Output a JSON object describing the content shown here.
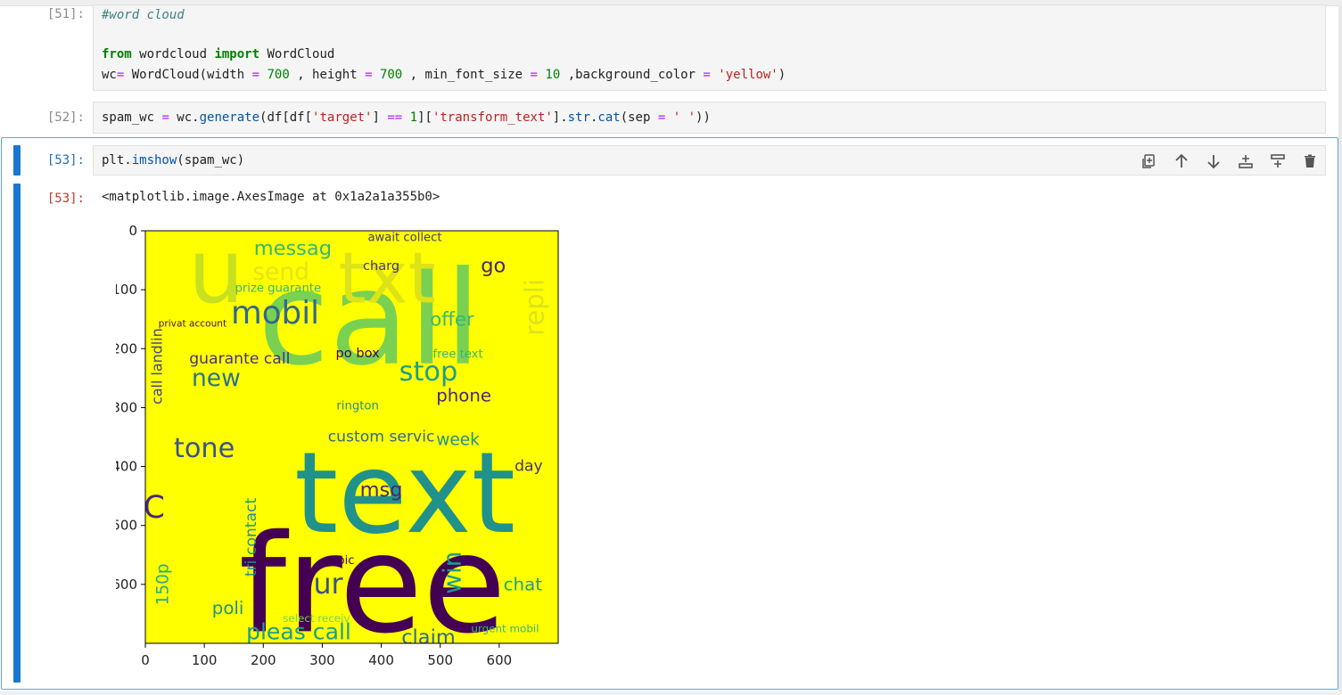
{
  "cells": [
    {
      "prompt": "[51]:",
      "lines": [
        [
          {
            "t": "#word cloud",
            "c": "cm-comment"
          }
        ],
        [],
        [
          {
            "t": "from",
            "c": "kw"
          },
          {
            "t": " wordcloud ",
            "c": ""
          },
          {
            "t": "import",
            "c": "kw"
          },
          {
            "t": " WordCloud",
            "c": ""
          }
        ],
        [
          {
            "t": "wc",
            "c": ""
          },
          {
            "t": "=",
            "c": "op"
          },
          {
            "t": " WordCloud(width ",
            "c": ""
          },
          {
            "t": "=",
            "c": "op"
          },
          {
            "t": " ",
            "c": ""
          },
          {
            "t": "700",
            "c": "num"
          },
          {
            "t": " , height ",
            "c": ""
          },
          {
            "t": "=",
            "c": "op"
          },
          {
            "t": " ",
            "c": ""
          },
          {
            "t": "700",
            "c": "num"
          },
          {
            "t": " , min_font_size ",
            "c": ""
          },
          {
            "t": "=",
            "c": "op"
          },
          {
            "t": " ",
            "c": ""
          },
          {
            "t": "10",
            "c": "num"
          },
          {
            "t": " ,background_color ",
            "c": ""
          },
          {
            "t": "=",
            "c": "op"
          },
          {
            "t": " ",
            "c": ""
          },
          {
            "t": "'yellow'",
            "c": "str"
          },
          {
            "t": ")",
            "c": ""
          }
        ]
      ]
    },
    {
      "prompt": "[52]:",
      "lines": [
        [
          {
            "t": "spam_wc ",
            "c": ""
          },
          {
            "t": "=",
            "c": "op"
          },
          {
            "t": " wc.",
            "c": ""
          },
          {
            "t": "generate",
            "c": "attr"
          },
          {
            "t": "(df[df[",
            "c": ""
          },
          {
            "t": "'target'",
            "c": "str"
          },
          {
            "t": "] ",
            "c": ""
          },
          {
            "t": "==",
            "c": "op"
          },
          {
            "t": " ",
            "c": ""
          },
          {
            "t": "1",
            "c": "num"
          },
          {
            "t": "][",
            "c": ""
          },
          {
            "t": "'transform_text'",
            "c": "str"
          },
          {
            "t": "].",
            "c": ""
          },
          {
            "t": "str",
            "c": "attr"
          },
          {
            "t": ".",
            "c": ""
          },
          {
            "t": "cat",
            "c": "attr"
          },
          {
            "t": "(sep ",
            "c": ""
          },
          {
            "t": "=",
            "c": "op"
          },
          {
            "t": " ",
            "c": ""
          },
          {
            "t": "' '",
            "c": "str"
          },
          {
            "t": "))",
            "c": ""
          }
        ]
      ]
    },
    {
      "prompt": "[53]:",
      "lines": [
        [
          {
            "t": "plt.",
            "c": ""
          },
          {
            "t": "imshow",
            "c": "attr"
          },
          {
            "t": "(spam_wc)",
            "c": ""
          }
        ]
      ]
    }
  ],
  "output": {
    "prompt": "[53]:",
    "text": "<matplotlib.image.AxesImage at 0x1a2a1a355b0>"
  },
  "toolbar": {
    "icons": [
      "duplicate-icon",
      "move-up-icon",
      "move-down-icon",
      "insert-above-icon",
      "insert-below-icon",
      "delete-icon"
    ]
  },
  "chart_data": {
    "type": "image",
    "background_color": "#ffff00",
    "x_ticks": [
      "0",
      "100",
      "200",
      "300",
      "400",
      "500",
      "600"
    ],
    "y_ticks": [
      "0",
      "100",
      "200",
      "300",
      "400",
      "500",
      "600"
    ],
    "xlim": [
      0,
      700
    ],
    "ylim": [
      700,
      0
    ],
    "words": [
      {
        "text": "free",
        "x": 385,
        "y": 600,
        "size": 230,
        "color": "#440154",
        "rot": 0
      },
      {
        "text": "call",
        "x": 380,
        "y": 150,
        "size": 220,
        "color": "#7ad151",
        "rot": 0
      },
      {
        "text": "text",
        "x": 440,
        "y": 445,
        "size": 190,
        "color": "#21918c",
        "rot": 0
      },
      {
        "text": "txt",
        "x": 410,
        "y": 80,
        "size": 120,
        "color": "#dde318",
        "rot": 0
      },
      {
        "text": "u",
        "x": 120,
        "y": 70,
        "size": 150,
        "color": "#c8e020",
        "rot": 0
      },
      {
        "text": "mobil",
        "x": 220,
        "y": 140,
        "size": 54,
        "color": "#31688e",
        "rot": 0
      },
      {
        "text": "tone",
        "x": 100,
        "y": 370,
        "size": 46,
        "color": "#3b528b",
        "rot": 0
      },
      {
        "text": "stop",
        "x": 480,
        "y": 240,
        "size": 46,
        "color": "#1f9e89",
        "rot": 0
      },
      {
        "text": "new",
        "x": 120,
        "y": 250,
        "size": 40,
        "color": "#2c728e",
        "rot": 0
      },
      {
        "text": "messag",
        "x": 250,
        "y": 30,
        "size": 34,
        "color": "#35b779",
        "rot": 0
      },
      {
        "text": "claim",
        "x": 480,
        "y": 690,
        "size": 34,
        "color": "#31688e",
        "rot": 0
      },
      {
        "text": "pleas call",
        "x": 260,
        "y": 680,
        "size": 38,
        "color": "#1f9e89",
        "rot": 0
      },
      {
        "text": "ur",
        "x": 310,
        "y": 600,
        "size": 48,
        "color": "#3b528b",
        "rot": 0
      },
      {
        "text": "chat",
        "x": 640,
        "y": 600,
        "size": 30,
        "color": "#1f9e89",
        "rot": 0
      },
      {
        "text": "phone",
        "x": 540,
        "y": 280,
        "size": 30,
        "color": "#482878",
        "rot": 0
      },
      {
        "text": "offer",
        "x": 520,
        "y": 150,
        "size": 32,
        "color": "#35b779",
        "rot": 0
      },
      {
        "text": "custom servic",
        "x": 400,
        "y": 350,
        "size": 26,
        "color": "#31688e",
        "rot": 0
      },
      {
        "text": "week",
        "x": 530,
        "y": 355,
        "size": 28,
        "color": "#21918c",
        "rot": 0
      },
      {
        "text": "msg",
        "x": 400,
        "y": 440,
        "size": 34,
        "color": "#482878",
        "rot": 0
      },
      {
        "text": "day",
        "x": 650,
        "y": 400,
        "size": 26,
        "color": "#46337e",
        "rot": 0
      },
      {
        "text": "go",
        "x": 590,
        "y": 60,
        "size": 34,
        "color": "#482878",
        "rot": 0
      },
      {
        "text": "guarante call",
        "x": 160,
        "y": 218,
        "size": 26,
        "color": "#46337e",
        "rot": 0
      },
      {
        "text": "prize guarante",
        "x": 225,
        "y": 98,
        "size": 20,
        "color": "#35b779",
        "rot": 0
      },
      {
        "text": "await collect",
        "x": 440,
        "y": 12,
        "size": 20,
        "color": "#443983",
        "rot": 0
      },
      {
        "text": "repli",
        "x": 660,
        "y": 130,
        "size": 44,
        "color": "#dde318",
        "rot": -90
      },
      {
        "text": "call landlin",
        "x": 20,
        "y": 230,
        "size": 24,
        "color": "#414487",
        "rot": -90
      },
      {
        "text": "win",
        "x": 520,
        "y": 580,
        "size": 42,
        "color": "#1f9e89",
        "rot": -90
      },
      {
        "text": "tri contact",
        "x": 180,
        "y": 520,
        "size": 26,
        "color": "#21918c",
        "rot": -90
      },
      {
        "text": "poli",
        "x": 140,
        "y": 640,
        "size": 30,
        "color": "#21918c",
        "rot": 0
      },
      {
        "text": "150p",
        "x": 30,
        "y": 600,
        "size": 28,
        "color": "#27ad81",
        "rot": -90
      },
      {
        "text": "rington",
        "x": 360,
        "y": 298,
        "size": 20,
        "color": "#21918c",
        "rot": 0
      },
      {
        "text": "po box",
        "x": 360,
        "y": 208,
        "size": 22,
        "color": "#440154",
        "rot": 0
      },
      {
        "text": "free text",
        "x": 530,
        "y": 210,
        "size": 20,
        "color": "#35b779",
        "rot": 0
      },
      {
        "text": "privat account",
        "x": 80,
        "y": 158,
        "size": 16,
        "color": "#471164",
        "rot": 0
      },
      {
        "text": "send",
        "x": 230,
        "y": 70,
        "size": 40,
        "color": "#e5e419",
        "rot": 0
      },
      {
        "text": "urgent mobil",
        "x": 610,
        "y": 675,
        "size": 18,
        "color": "#35b779",
        "rot": 0
      },
      {
        "text": "select receiv",
        "x": 290,
        "y": 658,
        "size": 18,
        "color": "#7ad151",
        "rot": 0
      },
      {
        "text": "charg",
        "x": 400,
        "y": 60,
        "size": 22,
        "color": "#46337e",
        "rot": 0
      },
      {
        "text": "pic",
        "x": 340,
        "y": 560,
        "size": 20,
        "color": "#440154",
        "rot": 0
      },
      {
        "text": "C",
        "x": 15,
        "y": 470,
        "size": 52,
        "color": "#482878",
        "rot": 0
      }
    ]
  }
}
